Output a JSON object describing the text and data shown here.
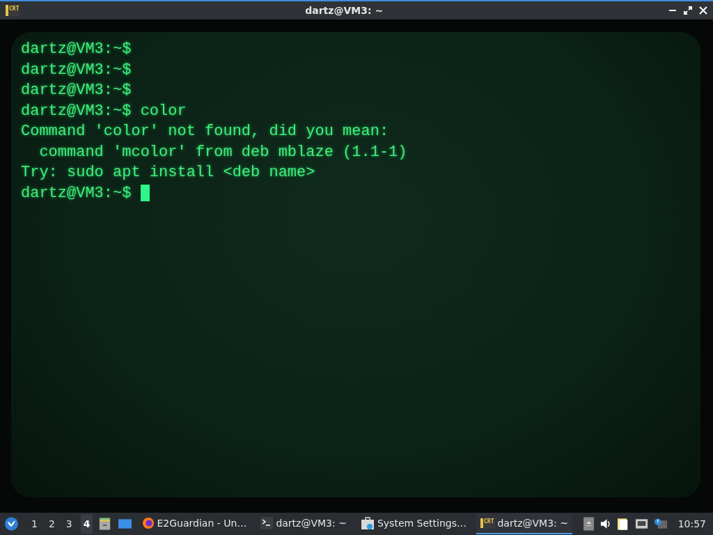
{
  "window": {
    "icon_label": "CRT",
    "title": "dartz@VM3: ~"
  },
  "terminal": {
    "lines": [
      {
        "text": "dartz@VM3:~$"
      },
      {
        "text": "dartz@VM3:~$"
      },
      {
        "text": "dartz@VM3:~$"
      },
      {
        "text": "dartz@VM3:~$ color"
      },
      {
        "text": "Command 'color' not found, did you mean:"
      },
      {
        "text": "  command 'mcolor' from deb mblaze (1.1-1)"
      },
      {
        "text": "Try: sudo apt install <deb name>"
      },
      {
        "text": "dartz@VM3:~$ "
      }
    ],
    "cursor": true
  },
  "taskbar": {
    "workspaces": [
      {
        "label": "1",
        "selected": false
      },
      {
        "label": "2",
        "selected": false
      },
      {
        "label": "3",
        "selected": false
      },
      {
        "label": "4",
        "selected": true
      }
    ],
    "tasks": [
      {
        "kind": "firefox",
        "label": "E2Guardian - Un…",
        "selected": false
      },
      {
        "kind": "terminal",
        "label": "dartz@VM3: ~",
        "selected": false
      },
      {
        "kind": "settings",
        "label": "System Settings…",
        "selected": false
      },
      {
        "kind": "crt",
        "icon_label": "CRT",
        "label": "dartz@VM3: ~",
        "selected": true
      }
    ],
    "clock": "10:57"
  }
}
